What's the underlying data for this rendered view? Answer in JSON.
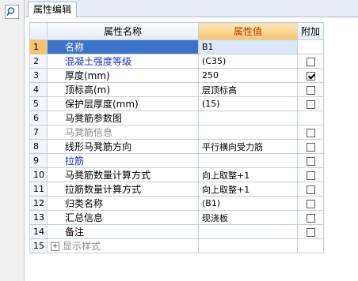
{
  "tab": {
    "label": "属性编辑"
  },
  "table": {
    "headers": {
      "name": "属性名称",
      "value": "属性值",
      "extra": "附加"
    },
    "rows": [
      {
        "num": "1",
        "name": "名称",
        "value": "B1",
        "checkbox": false,
        "checked": false
      },
      {
        "num": "2",
        "name": "混凝土强度等级",
        "value": "(C35)",
        "checkbox": true,
        "checked": false
      },
      {
        "num": "3",
        "name": "厚度(mm)",
        "value": "250",
        "checkbox": true,
        "checked": true
      },
      {
        "num": "4",
        "name": "顶标高(m)",
        "value": "层顶标高",
        "checkbox": true,
        "checked": false
      },
      {
        "num": "5",
        "name": "保护层厚度(mm)",
        "value": "(15)",
        "checkbox": true,
        "checked": false
      },
      {
        "num": "6",
        "name": "马凳筋参数图",
        "value": "",
        "checkbox": false,
        "checked": false
      },
      {
        "num": "7",
        "name": "马凳筋信息",
        "value": "",
        "checkbox": true,
        "checked": false
      },
      {
        "num": "8",
        "name": "线形马凳筋方向",
        "value": "平行横向受力筋",
        "checkbox": true,
        "checked": false
      },
      {
        "num": "9",
        "name": "拉筋",
        "value": "",
        "checkbox": true,
        "checked": false
      },
      {
        "num": "10",
        "name": "马凳筋数量计算方式",
        "value": "向上取整+1",
        "checkbox": true,
        "checked": false
      },
      {
        "num": "11",
        "name": "拉筋数量计算方式",
        "value": "向上取整+1",
        "checkbox": true,
        "checked": false
      },
      {
        "num": "12",
        "name": "归类名称",
        "value": "(B1)",
        "checkbox": true,
        "checked": false
      },
      {
        "num": "13",
        "name": "汇总信息",
        "value": "现浇板",
        "checkbox": true,
        "checked": false
      },
      {
        "num": "14",
        "name": "备注",
        "value": "",
        "checkbox": true,
        "checked": false
      },
      {
        "num": "15",
        "name": "显示样式",
        "value": "",
        "checkbox": false,
        "checked": false
      }
    ]
  },
  "colors": {
    "selected_row": "#3d74c7",
    "header_value": "#f9c46c",
    "blue_text": "#1f2fd2",
    "gray_text": "#8c8c8c"
  }
}
